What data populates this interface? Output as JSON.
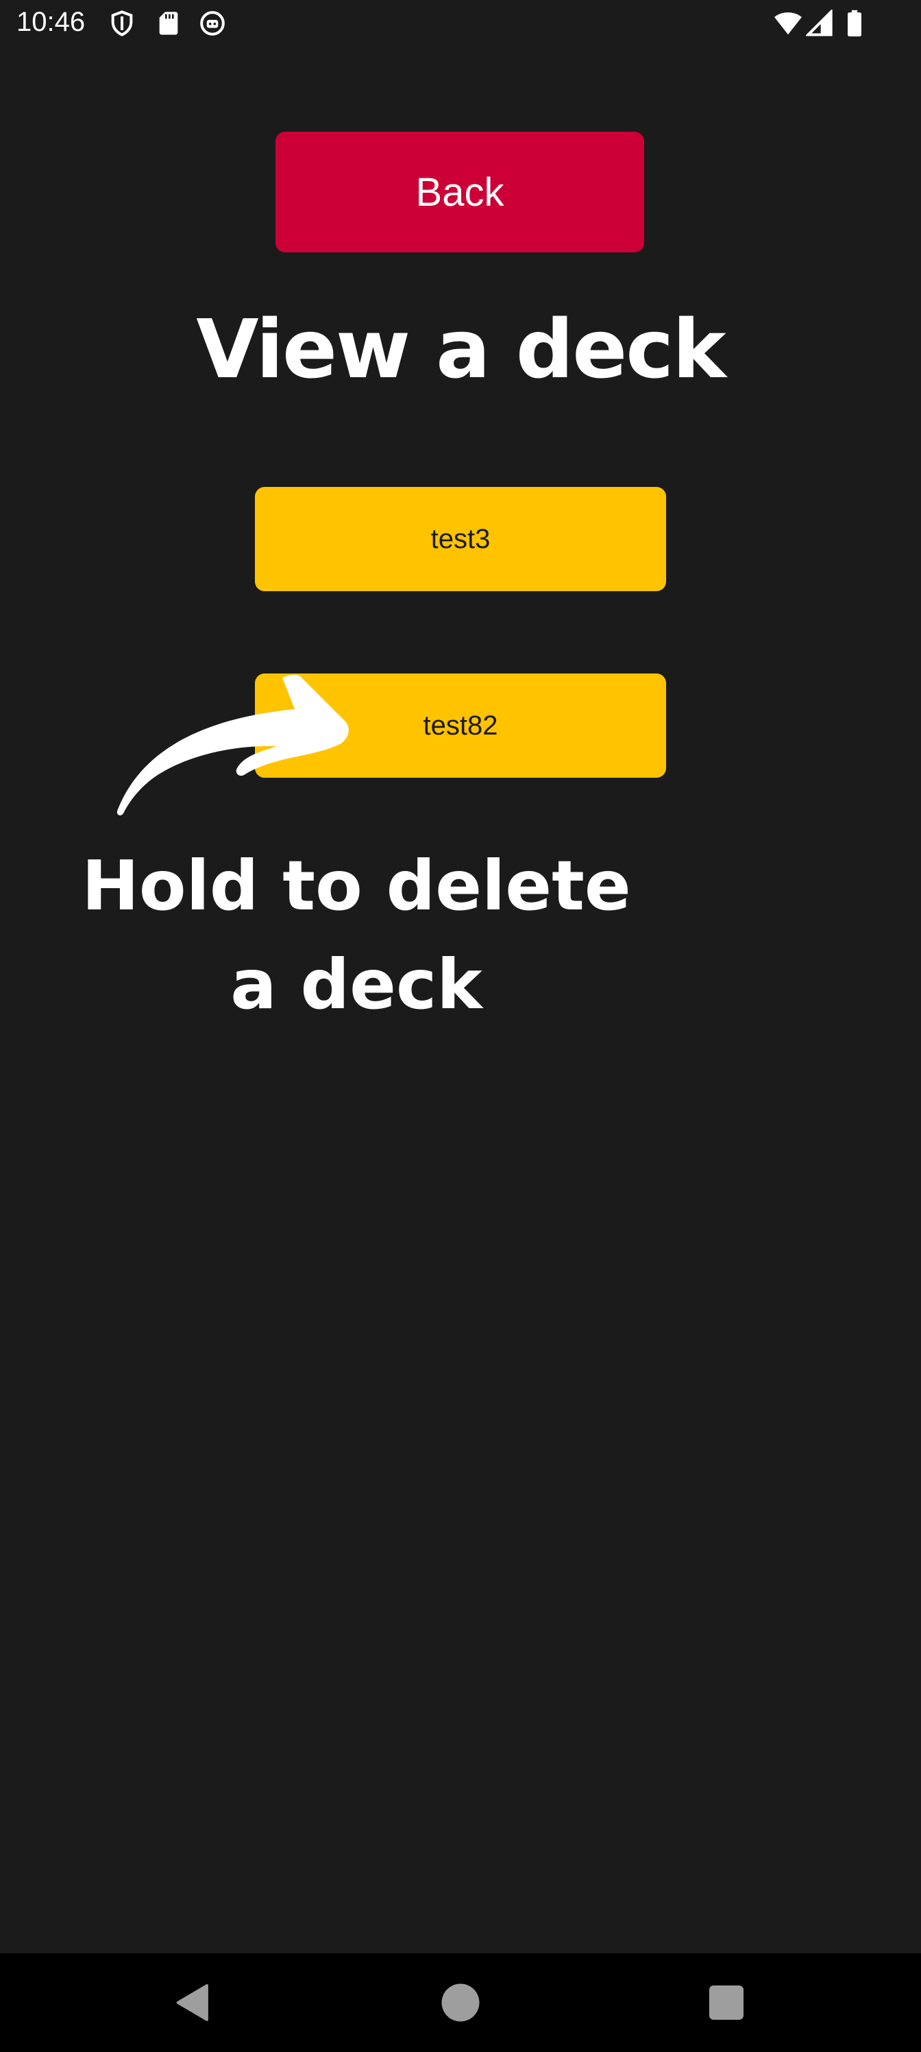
{
  "status_bar": {
    "time": "10:46",
    "icons_left": [
      "shield-icon",
      "sd-card-icon",
      "bot-icon"
    ],
    "icons_right": [
      "wifi-icon",
      "signal-icon",
      "battery-icon"
    ]
  },
  "header": {
    "back_label": "Back",
    "title": "View a deck"
  },
  "decks": [
    {
      "label": "test3"
    },
    {
      "label": "test82"
    }
  ],
  "hint": {
    "text": "Hold to delete a deck"
  },
  "nav_bar": {
    "buttons": [
      "back-nav-icon",
      "home-nav-icon",
      "recents-nav-icon"
    ]
  },
  "colors": {
    "background": "#1b1b1b",
    "back_button": "#cc0036",
    "deck_button": "#ffc300",
    "text": "#ffffff"
  }
}
